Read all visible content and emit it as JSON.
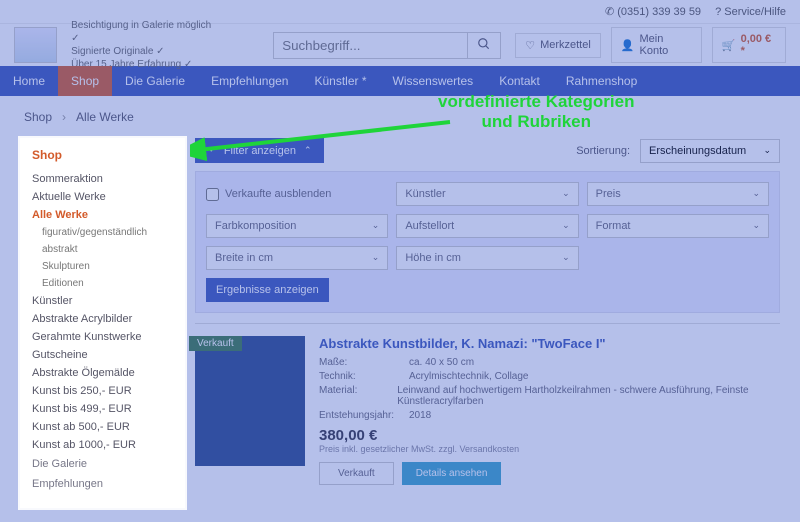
{
  "topbar": {
    "phone": "(0351) 339 39 59",
    "help": "Service/Hilfe"
  },
  "taglines": [
    "Besichtigung in Galerie möglich ✓",
    "Signierte Originale ✓",
    "Über 15 Jahre Erfahrung ✓"
  ],
  "search": {
    "placeholder": "Suchbegriff..."
  },
  "headerbtns": {
    "wishlist": "Merkzettel",
    "account": "Mein Konto",
    "cart": "0,00 € *"
  },
  "nav": [
    "Home",
    "Shop",
    "Die Galerie",
    "Empfehlungen",
    "Künstler *",
    "Wissenswertes",
    "Kontakt",
    "Rahmenshop"
  ],
  "nav_active": 1,
  "crumbs": [
    "Shop",
    "Alle Werke"
  ],
  "sidebar": {
    "heading": "Shop",
    "items": [
      {
        "l": "Sommeraktion"
      },
      {
        "l": "Aktuelle Werke"
      },
      {
        "l": "Alle Werke",
        "active": true
      },
      {
        "l": "figurativ/gegenständlich",
        "sub": true
      },
      {
        "l": "abstrakt",
        "sub": true
      },
      {
        "l": "Skulpturen",
        "sub": true
      },
      {
        "l": "Editionen",
        "sub": true
      },
      {
        "l": "Künstler"
      },
      {
        "l": "Abstrakte Acrylbilder"
      },
      {
        "l": "Gerahmte Kunstwerke"
      },
      {
        "l": "Gutscheine"
      },
      {
        "l": "Abstrakte Ölgemälde"
      },
      {
        "l": "Kunst bis 250,- EUR"
      },
      {
        "l": "Kunst bis 499,- EUR"
      },
      {
        "l": "Kunst ab 500,- EUR"
      },
      {
        "l": "Kunst ab 1000,- EUR"
      }
    ],
    "dimmed": [
      "Die Galerie",
      "Empfehlungen"
    ]
  },
  "filterbtn": "Filter anzeigen",
  "sort": {
    "label": "Sortierung:",
    "value": "Erscheinungsdatum"
  },
  "filters": {
    "hide_sold": "Verkaufte ausblenden",
    "sel": [
      "Künstler",
      "Preis",
      "Farbkomposition",
      "Aufstellort",
      "Format",
      "Breite in cm",
      "Höhe in cm"
    ],
    "results": "Ergebnisse anzeigen"
  },
  "product": {
    "sold": "Verkauft",
    "title": "Abstrakte Kunstbilder, K. Namazi: \"TwoFace I\"",
    "rows": [
      {
        "k": "Maße:",
        "v": "ca. 40 x 50 cm"
      },
      {
        "k": "Technik:",
        "v": "Acrylmischtechnik, Collage"
      },
      {
        "k": "Material:",
        "v": "Leinwand auf hochwertigem Hartholzkeilrahmen - schwere Ausführung, Feinste Künstleracrylfarben"
      },
      {
        "k": "Entstehungsjahr:",
        "v": "2018"
      }
    ],
    "price": "380,00 €",
    "note": "Preis inkl. gesetzlicher MwSt. zzgl. Versandkosten",
    "btn_sold": "Verkauft",
    "btn_detail": "Details ansehen"
  },
  "annotation": {
    "l1": "vordefinierte Kategorien",
    "l2": "und Rubriken"
  }
}
